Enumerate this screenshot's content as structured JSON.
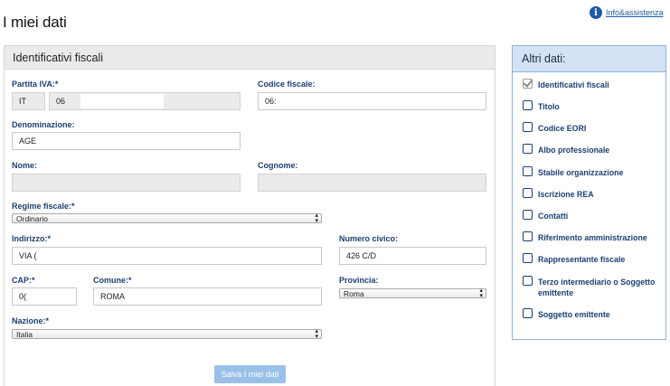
{
  "page": {
    "title": "I miei dati",
    "help_link": "Info&assistenza",
    "help_icon": "info-icon"
  },
  "form": {
    "section_title": "Identificativi fiscali",
    "partita_iva": {
      "label": "Partita IVA:*",
      "country": "IT",
      "value": "06"
    },
    "codice_fiscale": {
      "label": "Codice fiscale:",
      "value": "06:"
    },
    "denominazione": {
      "label": "Denominazione:",
      "value": "AGE"
    },
    "nome": {
      "label": "Nome:",
      "value": ""
    },
    "cognome": {
      "label": "Cognome:",
      "value": ""
    },
    "regime_fiscale": {
      "label": "Regime fiscale:*",
      "selected": "Ordinario"
    },
    "indirizzo": {
      "label": "Indirizzo:*",
      "value": "VIA ("
    },
    "numero_civico": {
      "label": "Numero civico:",
      "value": "426 C/D"
    },
    "cap": {
      "label": "CAP:*",
      "value": "0("
    },
    "comune": {
      "label": "Comune:*",
      "value": "ROMA"
    },
    "provincia": {
      "label": "Provincia:",
      "selected": "Roma"
    },
    "nazione": {
      "label": "Nazione:*",
      "selected": "Italia"
    },
    "save_label": "Salva I miei dati"
  },
  "sidebar": {
    "title": "Altri dati:",
    "items": [
      {
        "label": "Identificativi fiscali",
        "checked": true
      },
      {
        "label": "Titolo",
        "checked": false
      },
      {
        "label": "Codice EORI",
        "checked": false
      },
      {
        "label": "Albo professionale",
        "checked": false
      },
      {
        "label": "Stabile organizzazione",
        "checked": false
      },
      {
        "label": "Iscrizione REA",
        "checked": false
      },
      {
        "label": "Contatti",
        "checked": false
      },
      {
        "label": "Riferimento amministrazione",
        "checked": false
      },
      {
        "label": "Rappresentante fiscale",
        "checked": false
      },
      {
        "label": "Terzo intermediario o Soggetto emittente",
        "checked": false
      },
      {
        "label": "Soggetto emittente",
        "checked": false
      }
    ]
  }
}
